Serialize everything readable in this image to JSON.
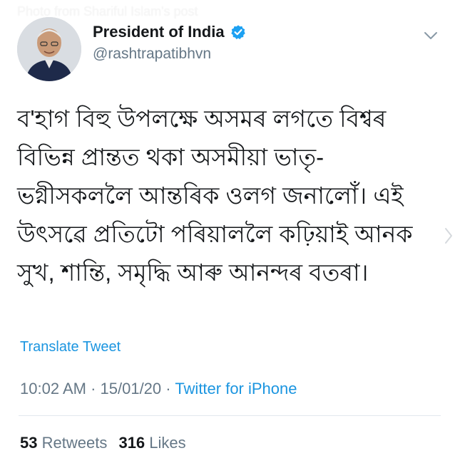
{
  "overlay": {
    "caption": "Photo from Shariful Islam's post"
  },
  "user": {
    "display_name": "President of India",
    "handle": "@rashtrapatibhvn",
    "verified": true,
    "avatar_icon": "person-portrait"
  },
  "tweet": {
    "text": "ব'হাগ বিহু উপলক্ষে অসমৰ লগতে বিশ্বৰ বিভিন্ন প্ৰান্তত থকা অসমীয়া ভাতৃ-ভগ্নীসকললৈ আন্তৰিক ওলগ জনালোঁ। এই উৎসৱে প্ৰতিটো পৰিয়াললৈ কঢ়িয়াই আনক সুখ, শান্তি, সমৃদ্ধি আৰু আনন্দৰ বতৰা।",
    "translate_label": "Translate Tweet",
    "time": "10:02 AM",
    "date": "15/01/20",
    "separator": " · ",
    "source": "Twitter for iPhone"
  },
  "stats": {
    "retweets_count": "53",
    "retweets_label": "Retweets",
    "likes_count": "316",
    "likes_label": "Likes"
  },
  "colors": {
    "link": "#1b95e0",
    "muted": "#657786",
    "text": "#14171a",
    "verified": "#1da1f2",
    "divider": "#e1e8ed"
  },
  "icons": {
    "verified": "verified-badge-icon",
    "menu": "chevron-down-icon"
  }
}
